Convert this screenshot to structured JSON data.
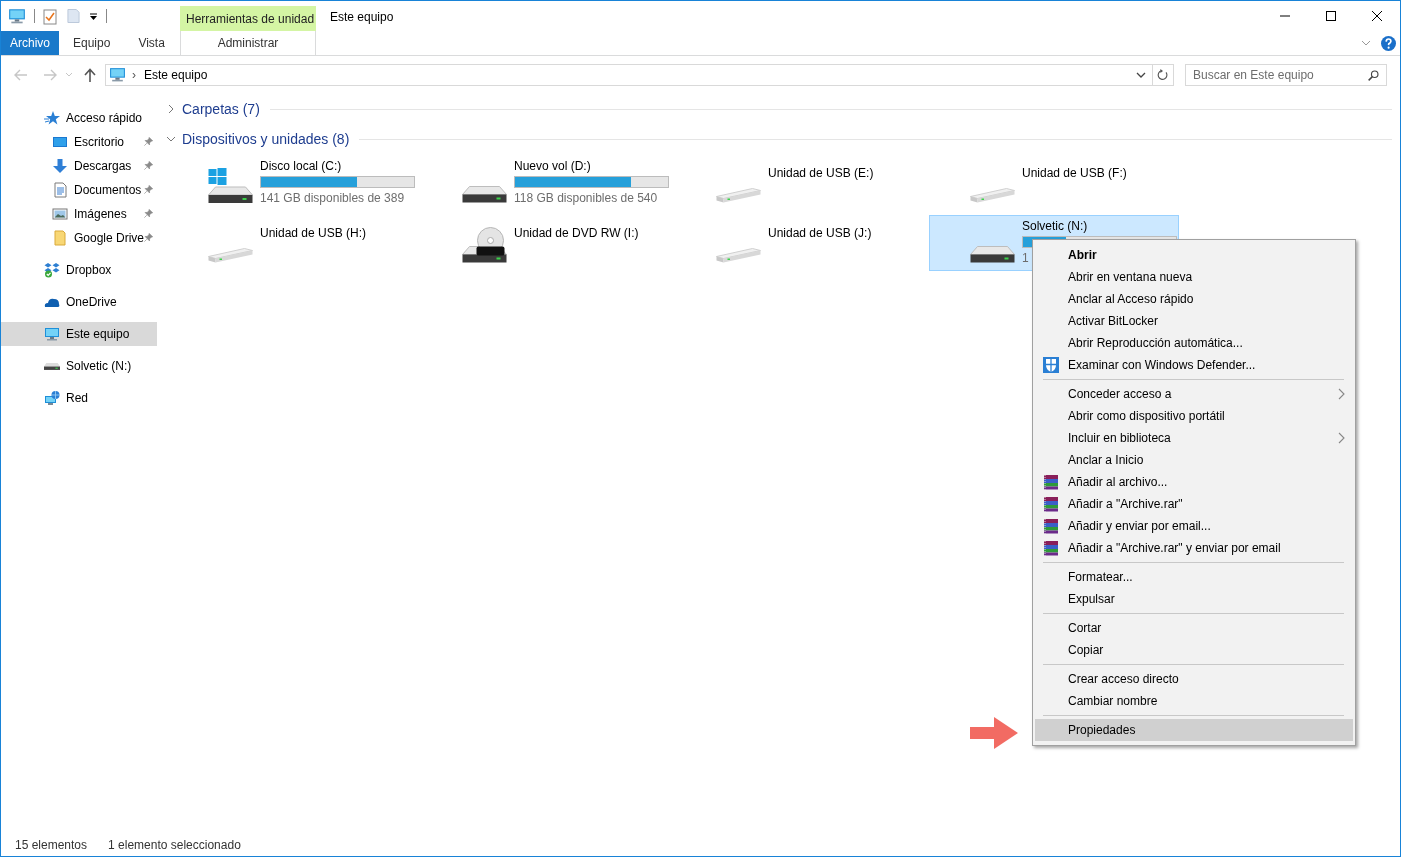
{
  "title_bar": {
    "contextual_group": "Herramientas de unidad",
    "title": "Este equipo"
  },
  "ribbon_tabs": [
    {
      "label": "Archivo",
      "kind": "file"
    },
    {
      "label": "Equipo",
      "kind": "normal"
    },
    {
      "label": "Vista",
      "kind": "normal"
    },
    {
      "label": "Administrar",
      "kind": "contextual"
    }
  ],
  "address_bar": {
    "separator": "›",
    "location": "Este equipo"
  },
  "search": {
    "placeholder": "Buscar en Este equipo"
  },
  "navigation_pane": {
    "items": [
      {
        "label": "Acceso rápido",
        "selected": false,
        "children": [
          {
            "label": "Escritorio",
            "selected": false,
            "pinned": true
          },
          {
            "label": "Descargas",
            "selected": false,
            "pinned": true
          },
          {
            "label": "Documentos",
            "selected": false,
            "pinned": true
          },
          {
            "label": "Imágenes",
            "selected": false,
            "pinned": true
          },
          {
            "label": "Google Drive",
            "selected": false,
            "pinned": true
          }
        ]
      },
      {
        "label": "Dropbox",
        "selected": false
      },
      {
        "label": "OneDrive",
        "selected": false
      },
      {
        "label": "Este equipo",
        "selected": true
      },
      {
        "label": "Solvetic (N:)",
        "selected": false
      },
      {
        "label": "Red",
        "selected": false
      }
    ]
  },
  "groups": [
    {
      "label": "Carpetas (7)",
      "expanded": false
    },
    {
      "label": "Dispositivos y unidades (8)",
      "expanded": true,
      "drives": [
        {
          "name": "Disco local (C:)",
          "kind": "windows",
          "level": 0.63,
          "free": "141 GB disponibles de 389",
          "selected": false
        },
        {
          "name": "Nuevo vol (D:)",
          "kind": "hdd",
          "level": 0.76,
          "free": "118 GB disponibles de 540",
          "selected": false
        },
        {
          "name": "Unidad de USB (E:)",
          "kind": "usb",
          "selected": false
        },
        {
          "name": "Unidad de USB (F:)",
          "kind": "usb",
          "selected": false
        },
        {
          "name": "Unidad de USB (H:)",
          "kind": "usb",
          "selected": false
        },
        {
          "name": "Unidad de DVD RW (I:)",
          "kind": "dvd",
          "selected": false
        },
        {
          "name": "Unidad de USB (J:)",
          "kind": "usb",
          "selected": false
        },
        {
          "name": "Solvetic (N:)",
          "kind": "hdd",
          "level": 0.28,
          "free": "1",
          "selected": true
        }
      ]
    }
  ],
  "context_menu": {
    "sections": [
      [
        {
          "label": "Abrir",
          "kind": "default",
          "submenu": false,
          "selected": false
        },
        {
          "label": "Abrir en ventana nueva",
          "kind": "plain",
          "submenu": false,
          "selected": false
        },
        {
          "label": "Anclar al Acceso rápido",
          "kind": "plain",
          "submenu": false,
          "selected": false
        },
        {
          "label": "Activar BitLocker",
          "kind": "plain",
          "submenu": false,
          "selected": false
        },
        {
          "label": "Abrir Reproducción automática...",
          "kind": "plain",
          "submenu": false,
          "selected": false
        },
        {
          "label": "Examinar con Windows Defender...",
          "kind": "shield",
          "submenu": false,
          "selected": false
        }
      ],
      [
        {
          "label": "Conceder acceso a",
          "kind": "plain",
          "submenu": true,
          "selected": false
        },
        {
          "label": "Abrir como dispositivo portátil",
          "kind": "plain",
          "submenu": false,
          "selected": false
        },
        {
          "label": "Incluir en biblioteca",
          "kind": "plain",
          "submenu": true,
          "selected": false
        },
        {
          "label": "Anclar a Inicio",
          "kind": "plain",
          "submenu": false,
          "selected": false
        },
        {
          "label": "Añadir al archivo...",
          "kind": "archive",
          "submenu": false,
          "selected": false
        },
        {
          "label": "Añadir a \"Archive.rar\"",
          "kind": "archive",
          "submenu": false,
          "selected": false
        },
        {
          "label": "Añadir y enviar por email...",
          "kind": "archive",
          "submenu": false,
          "selected": false
        },
        {
          "label": "Añadir a \"Archive.rar\" y enviar por email",
          "kind": "archive",
          "submenu": false,
          "selected": false
        }
      ],
      [
        {
          "label": "Formatear...",
          "kind": "plain",
          "submenu": false,
          "selected": false
        },
        {
          "label": "Expulsar",
          "kind": "plain",
          "submenu": false,
          "selected": false
        }
      ],
      [
        {
          "label": "Cortar",
          "kind": "plain",
          "submenu": false,
          "selected": false
        },
        {
          "label": "Copiar",
          "kind": "plain",
          "submenu": false,
          "selected": false
        }
      ],
      [
        {
          "label": "Crear acceso directo",
          "kind": "plain",
          "submenu": false,
          "selected": false
        },
        {
          "label": "Cambiar nombre",
          "kind": "plain",
          "submenu": false,
          "selected": false
        }
      ],
      [
        {
          "label": "Propiedades",
          "kind": "plain",
          "submenu": false,
          "selected": true
        }
      ]
    ]
  },
  "status_bar": {
    "item_count": "15 elementos",
    "selection": "1 elemento seleccionado"
  }
}
